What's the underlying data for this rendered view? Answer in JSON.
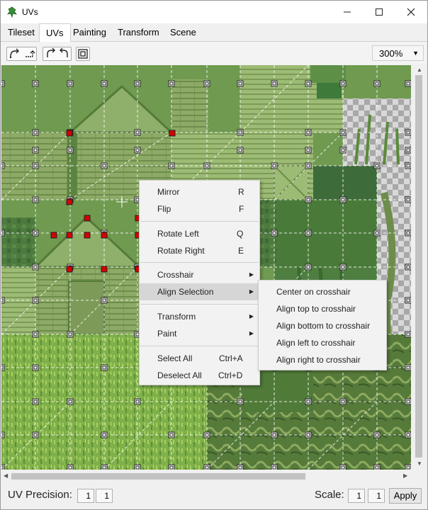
{
  "window": {
    "title": "UVs"
  },
  "tabs": [
    {
      "label": "Tileset",
      "active": false
    },
    {
      "label": "UVs",
      "active": true
    },
    {
      "label": "Painting",
      "active": false
    },
    {
      "label": "Transform",
      "active": false
    },
    {
      "label": "Scene",
      "active": false
    }
  ],
  "toolbar": {
    "zoom": "300%"
  },
  "context_menu": {
    "items": [
      {
        "label": "Mirror",
        "shortcut": "R"
      },
      {
        "label": "Flip",
        "shortcut": "F"
      },
      {
        "label": "Rotate Left",
        "shortcut": "Q"
      },
      {
        "label": "Rotate Right",
        "shortcut": "E"
      },
      {
        "label": "Crosshair",
        "submenu": true
      },
      {
        "label": "Align Selection",
        "submenu": true,
        "highlighted": true
      },
      {
        "label": "Transform",
        "submenu": true
      },
      {
        "label": "Paint",
        "submenu": true
      },
      {
        "label": "Select All",
        "shortcut": "Ctrl+A"
      },
      {
        "label": "Deselect All",
        "shortcut": "Ctrl+D"
      }
    ]
  },
  "submenu": {
    "items": [
      {
        "label": "Center on crosshair"
      },
      {
        "label": "Align top to crosshair"
      },
      {
        "label": "Align bottom to crosshair"
      },
      {
        "label": "Align left to crosshair"
      },
      {
        "label": "Align right to crosshair"
      }
    ]
  },
  "status": {
    "uv_precision_label": "UV Precision:",
    "uv_precision_x": "1",
    "uv_precision_y": "1",
    "scale_label": "Scale:",
    "scale_x": "1",
    "scale_y": "1",
    "apply_label": "Apply"
  },
  "colors": {
    "grass": "#6f9a50",
    "wood": "#8fae6a",
    "dark_green": "#3e6b3a",
    "selected_handle": "#d40000",
    "menu_highlight": "#d6d6d6"
  }
}
